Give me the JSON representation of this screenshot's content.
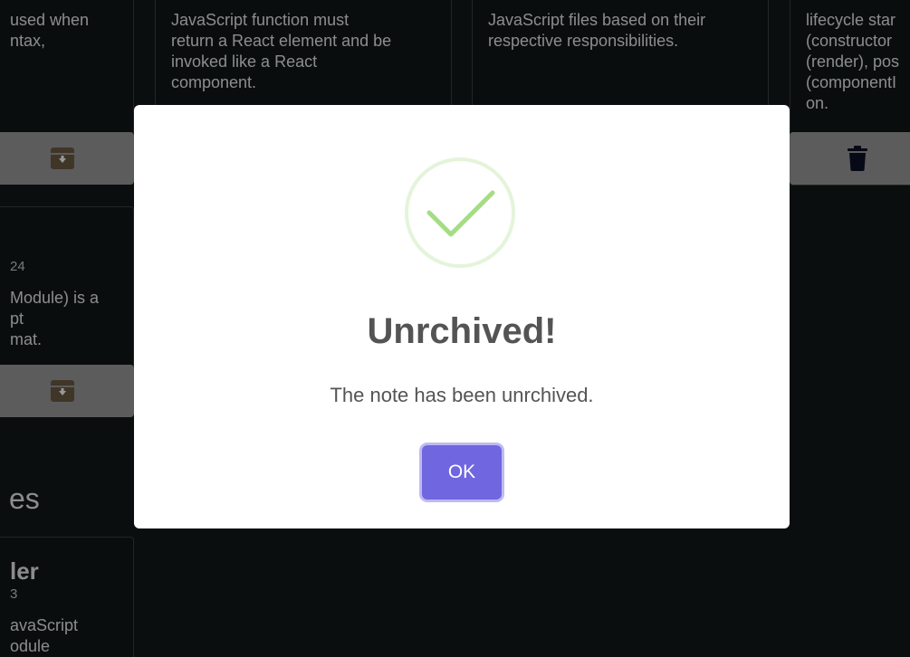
{
  "background_cards": {
    "card1": {
      "body": "used when\nntax,"
    },
    "card2": {
      "body": "JavaScript function must\nreturn a React element and be\ninvoked like a React\ncomponent."
    },
    "card3": {
      "body": "JavaScript files based on their\nrespective responsibilities."
    },
    "card4": {
      "body": "lifecycle star\n(constructor\n(render), pos\n(componentI\non."
    },
    "card5": {
      "date": "24",
      "body": "Module) is a\npt\nmat."
    },
    "card6": {
      "title": "ler",
      "date": "3",
      "body": "avaScript\nodule"
    }
  },
  "section": {
    "title": "es"
  },
  "buttons": {
    "archive_icon": "archive-icon",
    "delete_icon": "trash-icon"
  },
  "modal": {
    "icon": "success-check-icon",
    "title": "Unrchived!",
    "text": "The note has been unrchived.",
    "confirm_label": "OK"
  },
  "colors": {
    "background": "#131818",
    "modal_bg": "#ffffff",
    "confirm_button": "#7066e0",
    "success_check": "#a5dc86",
    "archive_button": "#9a9a9a",
    "trash_icon": "#0b1026"
  }
}
